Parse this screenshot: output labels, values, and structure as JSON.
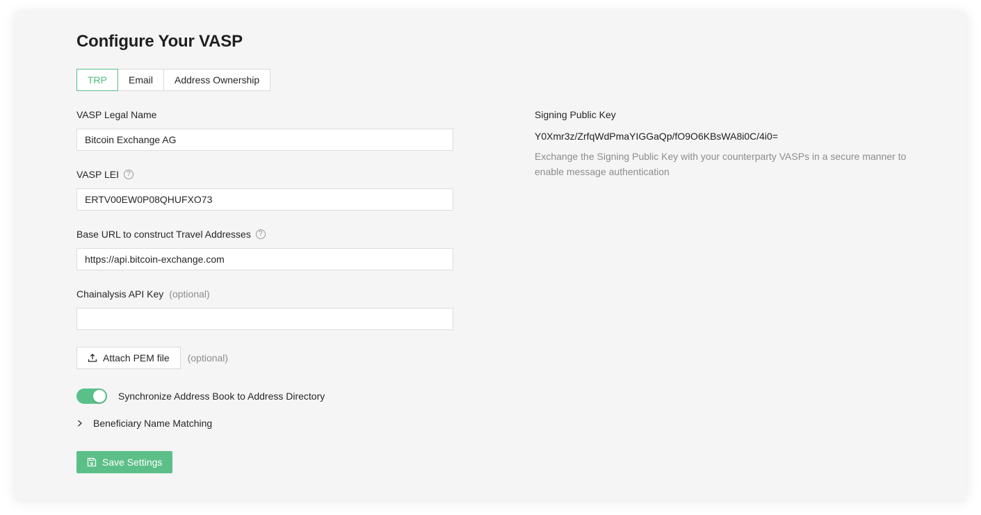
{
  "page": {
    "title": "Configure Your VASP"
  },
  "tabs": [
    {
      "label": "TRP",
      "active": true
    },
    {
      "label": "Email",
      "active": false
    },
    {
      "label": "Address Ownership",
      "active": false
    }
  ],
  "form": {
    "legal_name": {
      "label": "VASP Legal Name",
      "value": "Bitcoin Exchange AG"
    },
    "lei": {
      "label": "VASP LEI",
      "value": "ERTV00EW0P08QHUFXO73",
      "help_icon": "question-circle-icon"
    },
    "base_url": {
      "label": "Base URL to construct Travel Addresses",
      "value": "https://api.bitcoin-exchange.com",
      "help_icon": "question-circle-icon"
    },
    "chainalysis": {
      "label": "Chainalysis API Key",
      "optional": "(optional)",
      "value": ""
    },
    "pem": {
      "button_label": "Attach PEM file",
      "optional": "(optional)",
      "icon": "upload-icon"
    },
    "sync": {
      "label": "Synchronize Address Book to Address Directory",
      "enabled": true
    },
    "beneficiary": {
      "label": "Beneficiary Name Matching",
      "expanded": false,
      "icon": "chevron-right-icon"
    },
    "save": {
      "label": "Save Settings",
      "icon": "save-icon"
    }
  },
  "signing": {
    "label": "Signing Public Key",
    "key": "Y0Xmr3z/ZrfqWdPmaYIGGaQp/fO9O6KBsWA8i0C/4i0=",
    "description": "Exchange the Signing Public Key with your counterparty VASPs in a secure manner to enable message authentication"
  },
  "colors": {
    "accent": "#59c089",
    "save_button": "#5dbf88",
    "background": "#f5f5f5"
  }
}
